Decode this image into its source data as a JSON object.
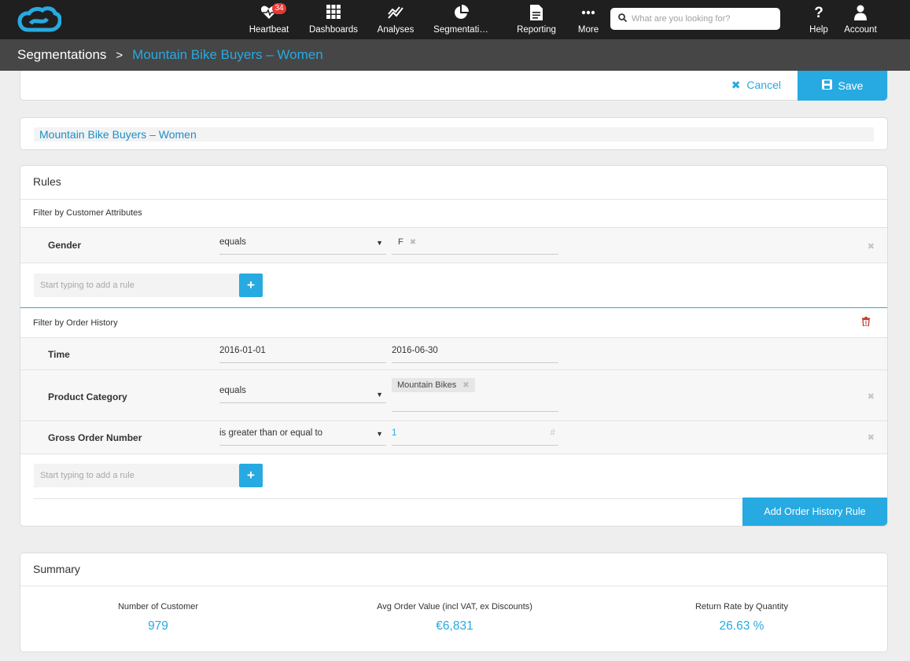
{
  "nav": {
    "items": [
      {
        "label": "Heartbeat",
        "icon": "heartbeat-icon",
        "badge": "34"
      },
      {
        "label": "Dashboards",
        "icon": "grid-icon"
      },
      {
        "label": "Analyses",
        "icon": "trend-icon"
      },
      {
        "label": "Segmentati…",
        "icon": "pie-icon"
      },
      {
        "label": "Reporting",
        "icon": "document-icon"
      },
      {
        "label": "More",
        "icon": "more-icon"
      },
      {
        "label": "Help",
        "icon": "question-icon"
      },
      {
        "label": "Account",
        "icon": "user-icon"
      }
    ],
    "search_placeholder": "What are you looking for?"
  },
  "breadcrumb": {
    "root": "Segmentations",
    "separator": ">",
    "current": "Mountain Bike Buyers – Women"
  },
  "actions": {
    "cancel": "Cancel",
    "save": "Save"
  },
  "segment_name": "Mountain Bike Buyers – Women",
  "rules": {
    "title": "Rules",
    "customer_attributes": {
      "title": "Filter by Customer Attributes",
      "rows": [
        {
          "label": "Gender",
          "operator": "equals",
          "tag": "F"
        }
      ],
      "add_placeholder": "Start typing to add a rule",
      "add_button": "+"
    },
    "order_history": {
      "title": "Filter by Order History",
      "time": {
        "label": "Time",
        "from": "2016-01-01",
        "to": "2016-06-30"
      },
      "product_category": {
        "label": "Product Category",
        "operator": "equals",
        "tag": "Mountain Bikes"
      },
      "gross_order_number": {
        "label": "Gross Order Number",
        "operator": "is greater than or equal to",
        "value": "1",
        "unit_symbol": "#"
      },
      "add_placeholder": "Start typing to add a rule",
      "add_button": "+",
      "add_order_history_rule": "Add Order History Rule"
    }
  },
  "summary": {
    "title": "Summary",
    "metrics": [
      {
        "label": "Number of Customer",
        "value": "979"
      },
      {
        "label": "Avg Order Value (incl VAT, ex Discounts)",
        "value": "€6,831"
      },
      {
        "label": "Return Rate by Quantity",
        "value": "26.63 %"
      }
    ]
  },
  "colors": {
    "accent": "#27aae1",
    "nav_bg": "#1f1f1f",
    "crumb_bg": "#464646",
    "badge": "#e53935",
    "danger": "#c0392b"
  }
}
